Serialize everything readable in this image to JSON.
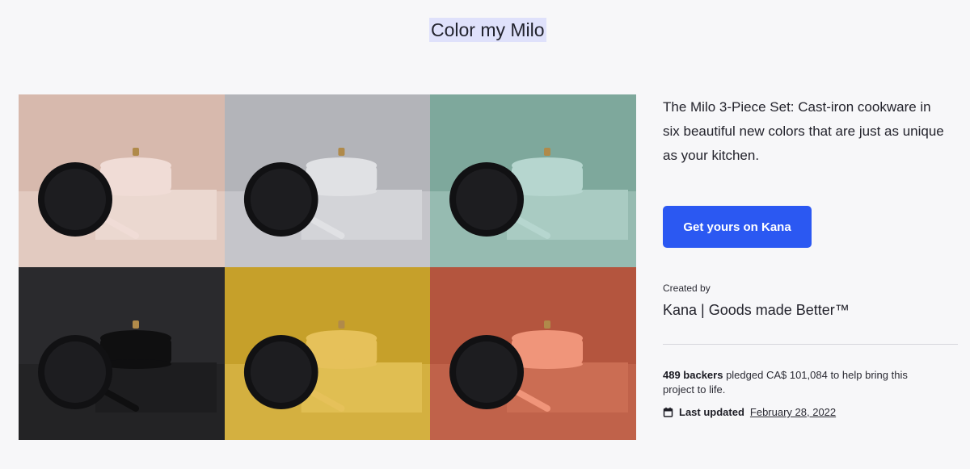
{
  "page": {
    "title": "Color my Milo"
  },
  "gallery": {
    "tiles": [
      {
        "name": "blush",
        "bg": "#d7b9ad",
        "table": "#ebd8d0",
        "pot": "#f0dcd6"
      },
      {
        "name": "grey",
        "bg": "#b3b4b9",
        "table": "#d3d4d8",
        "pot": "#e0e1e4"
      },
      {
        "name": "sage",
        "bg": "#7ea89c",
        "table": "#a9cbc2",
        "pot": "#b6d6cf"
      },
      {
        "name": "black",
        "bg": "#2a2a2d",
        "table": "#1d1d1f",
        "pot": "#0f0f10"
      },
      {
        "name": "mustard",
        "bg": "#c6a02a",
        "table": "#e0be52",
        "pot": "#e6c15a"
      },
      {
        "name": "terracotta",
        "bg": "#b4553e",
        "table": "#cb6d53",
        "pot": "#f0957a"
      }
    ]
  },
  "product": {
    "description": "The Milo 3-Piece Set: Cast-iron cookware in six beautiful new colors that are just as unique as your kitchen.",
    "cta_label": "Get yours on Kana",
    "created_by_label": "Created by",
    "creator_name": "Kana | Goods made Better™",
    "backers_count": "489 backers",
    "backers_text": " pledged CA$ 101,084 to help bring this project to life.",
    "last_updated_label": "Last updated",
    "last_updated_date": "February 28, 2022"
  },
  "colors": {
    "accent": "#2b58f2",
    "highlight": "#dfe1fb"
  }
}
